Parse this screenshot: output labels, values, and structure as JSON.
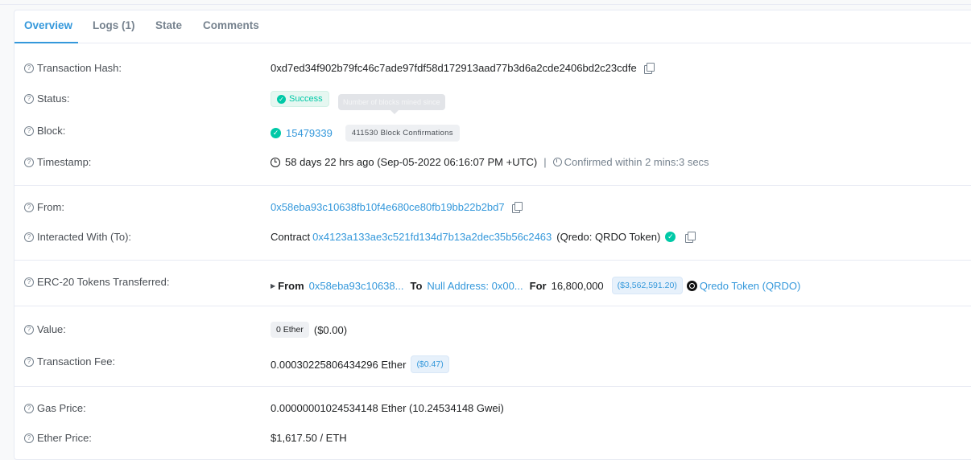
{
  "tabs": [
    {
      "label": "Overview",
      "active": true
    },
    {
      "label": "Logs (1)",
      "active": false
    },
    {
      "label": "State",
      "active": false
    },
    {
      "label": "Comments",
      "active": false
    }
  ],
  "rows": {
    "tx_hash": {
      "label": "Transaction Hash:",
      "value": "0xd7ed34f902b79fc46c7ade97fdf58d172913aad77b3d6a2cde2406bd2c23cdfe"
    },
    "status": {
      "label": "Status:",
      "value": "Success"
    },
    "block": {
      "label": "Block:",
      "value": "15479339",
      "confirmations": "411530 Block Confirmations",
      "tooltip": "Number of blocks mined since"
    },
    "timestamp": {
      "label": "Timestamp:",
      "value": "58 days 22 hrs ago (Sep-05-2022 06:16:07 PM +UTC)",
      "separator": "|",
      "confirmed": "Confirmed within 2 mins:3 secs"
    },
    "from": {
      "label": "From:",
      "value": "0x58eba93c10638fb10f4e680ce80fb19bb22b2bd7"
    },
    "to": {
      "label": "Interacted With (To):",
      "prefix": "Contract",
      "address": "0x4123a133ae3c521fd134d7b13a2dec35b56c2463",
      "name": "(Qredo: QRDO Token)"
    },
    "erc20": {
      "label": "ERC-20 Tokens Transferred:",
      "from_label": "From",
      "from_value": "0x58eba93c10638...",
      "to_label": "To",
      "to_value": "Null Address: 0x00...",
      "for_label": "For",
      "amount": "16,800,000",
      "usd": "($3,562,591.20)",
      "token": "Qredo Token (QRDO)"
    },
    "value": {
      "label": "Value:",
      "pill": "0 Ether",
      "usd": "($0.00)"
    },
    "fee": {
      "label": "Transaction Fee:",
      "value": "0.00030225806434296 Ether",
      "usd": "($0.47)"
    },
    "gas_price": {
      "label": "Gas Price:",
      "value": "0.00000001024534148 Ether (10.24534148 Gwei)"
    },
    "ether_price": {
      "label": "Ether Price:",
      "value": "$1,617.50 / ETH"
    }
  },
  "colors": {
    "accent": "#3498db",
    "success": "#00c9a7"
  }
}
